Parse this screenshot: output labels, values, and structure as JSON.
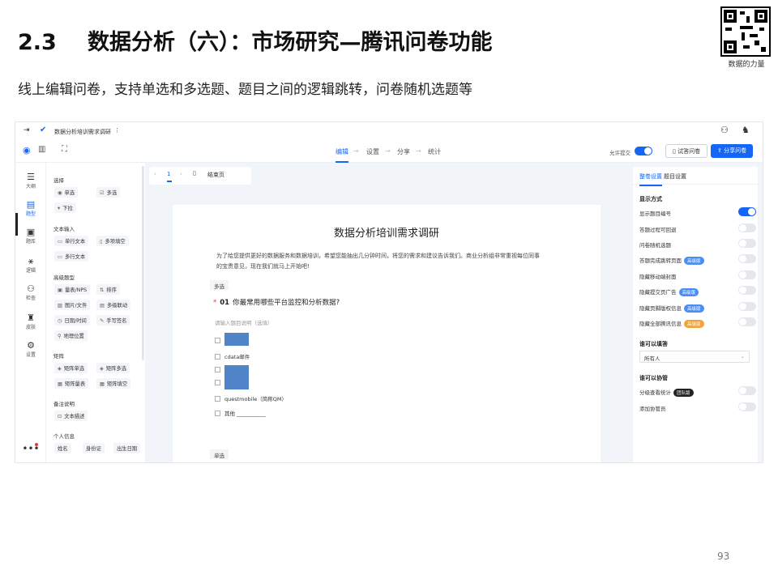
{
  "slide": {
    "section_number": "2.3",
    "title": "数据分析（六）：市场研究—腾讯问卷功能",
    "subtitle": "线上编辑问卷，支持单选和多选题、题目之间的逻辑跳转，问卷随机选题等",
    "qr_caption": "数据的力量",
    "page_number": "93"
  },
  "app": {
    "window_title": "数据分析培训需求调研",
    "steps": [
      "编辑",
      "设置",
      "分享",
      "统计"
    ],
    "active_step": "编辑",
    "allow_submit_label": "允许提交",
    "allow_submit_on": true,
    "preview_button": "试答问卷",
    "share_button": "分享问卷",
    "accent_color": "#1666f5"
  },
  "rail": [
    {
      "icon": "outline-icon",
      "glyph": "☰",
      "label": "大纲"
    },
    {
      "icon": "question-icon",
      "glyph": "▤",
      "label": "题型"
    },
    {
      "icon": "bank-icon",
      "glyph": "▣",
      "label": "题库"
    },
    {
      "icon": "logic-icon",
      "glyph": "⚹",
      "label": "逻辑"
    },
    {
      "icon": "check-icon",
      "glyph": "⚇",
      "label": "检查"
    },
    {
      "icon": "skin-icon",
      "glyph": "♜",
      "label": "皮肤"
    },
    {
      "icon": "settings-icon",
      "glyph": "⚙",
      "label": "设置"
    }
  ],
  "palette": {
    "sections": [
      {
        "heading": "选择",
        "items": [
          [
            "◉",
            "单选"
          ],
          [
            "☑",
            "多选"
          ],
          [
            "▾",
            "下拉"
          ]
        ]
      },
      {
        "heading": "文本输入",
        "items": [
          [
            "▭",
            "单行文本"
          ],
          [
            "▯",
            "多项填空"
          ],
          [
            "▭",
            "多行文本"
          ]
        ]
      },
      {
        "heading": "高级题型",
        "items": [
          [
            "▣",
            "量表/NPS"
          ],
          [
            "⇅",
            "排序"
          ],
          [
            "▨",
            "图片/文件"
          ],
          [
            "▤",
            "多级联动"
          ],
          [
            "◷",
            "日期/时间"
          ],
          [
            "✎",
            "手写签名"
          ],
          [
            "⚲",
            "地理位置"
          ]
        ]
      },
      {
        "heading": "矩阵",
        "items": [
          [
            "◈",
            "矩阵单选"
          ],
          [
            "◈",
            "矩阵多选"
          ],
          [
            "▦",
            "矩阵量表"
          ],
          [
            "▦",
            "矩阵填空"
          ]
        ]
      },
      {
        "heading": "备注说明",
        "items": [
          [
            "⊡",
            "文本描述"
          ]
        ]
      },
      {
        "heading": "个人信息",
        "items": [
          [
            "",
            "姓名"
          ],
          [
            "",
            "身份证"
          ],
          [
            "",
            "出生日期"
          ]
        ]
      }
    ]
  },
  "canvas": {
    "page_current": "1",
    "end_page_label": "结束页"
  },
  "form": {
    "title": "数据分析培训需求调研",
    "description": "为了给您提供更好的数据服务和数据培训，希望您能抽出几分钟时间，将您的需求和建议告诉我们。商业分析组非常重视每位同事的宝贵意见，现在我们就马上开始吧!",
    "question_type_tag": "多选",
    "question_number": "01",
    "question_text": "你最常用哪些平台监控和分析数据?",
    "hint": "请输入题目说明（选填）",
    "options": [
      "",
      "cdata邮件",
      "",
      "",
      "questmobile（简称QM）",
      "其他 ___________"
    ],
    "next_type_tag": "单选"
  },
  "right_panel": {
    "tabs": [
      "整卷设置",
      "题目设置"
    ],
    "display_heading": "显示方式",
    "display_rows": [
      {
        "label": "显示题目编号",
        "badge": "",
        "on": true
      },
      {
        "label": "答题过程可回退",
        "badge": "",
        "on": false
      },
      {
        "label": "问卷随机选题",
        "badge": "",
        "on": false
      },
      {
        "label": "答题完成跳转页面",
        "badge": "高级版",
        "on": false
      },
      {
        "label": "隐藏移动端封面",
        "badge": "",
        "on": false
      },
      {
        "label": "隐藏提交页广告",
        "badge": "高级版",
        "on": false
      },
      {
        "label": "隐藏页脚版权信息",
        "badge": "高级版",
        "on": false
      },
      {
        "label": "隐藏全部腾讯信息",
        "badge": "高级版",
        "on": false
      }
    ],
    "who_fill_heading": "谁可以填答",
    "who_fill_value": "所有人",
    "who_collab_heading": "谁可以协管",
    "collab_rows": [
      {
        "label": "分级查看统计",
        "badge": "团队版",
        "on": false
      },
      {
        "label": "添加协管员",
        "badge": "",
        "on": false
      }
    ]
  }
}
